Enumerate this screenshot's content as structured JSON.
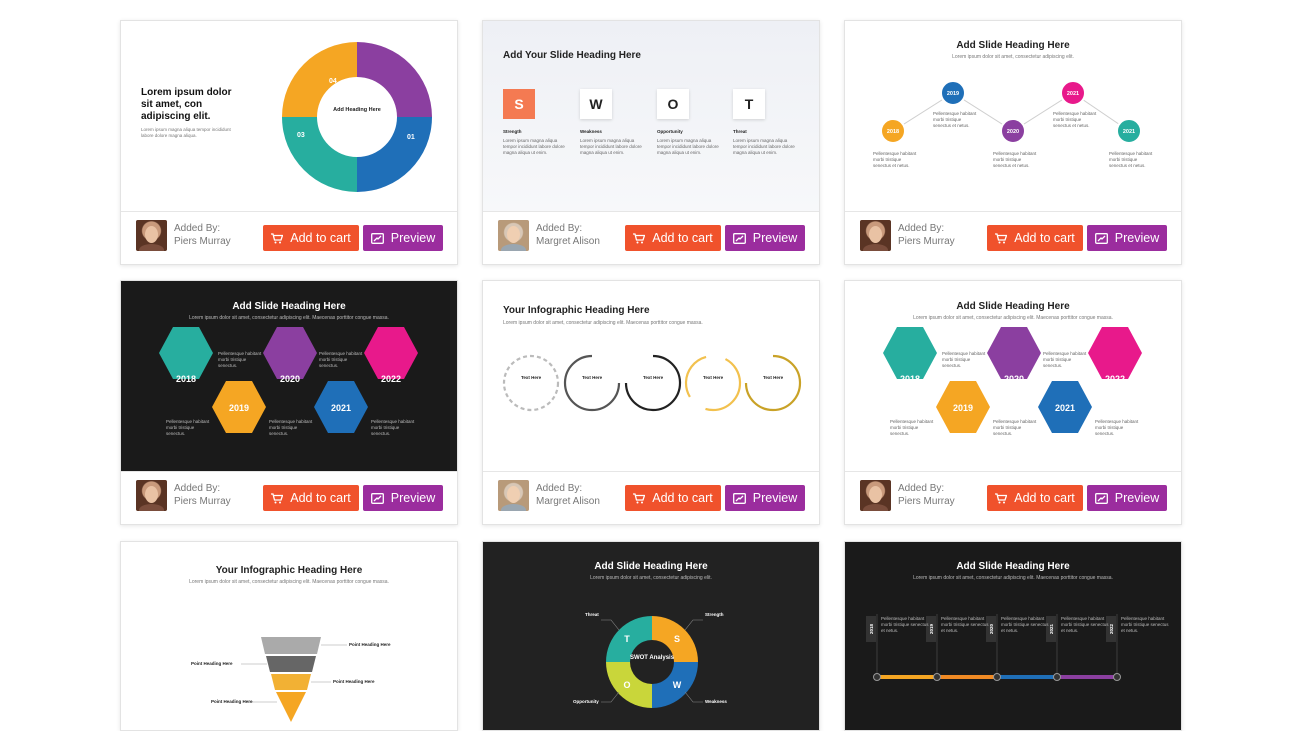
{
  "colors": {
    "cart": "#f0522c",
    "preview": "#9b2d9e"
  },
  "cards": [
    {
      "author_label": "Added By:",
      "author": "Piers Murray",
      "cart_label": "Add to cart",
      "preview_label": "Preview",
      "lead": "Lorem ipsum dolor sit amet, con adipiscing elit.",
      "center": "Add Heading Here",
      "segments": [
        "04",
        "01",
        "02",
        "03"
      ]
    },
    {
      "author_label": "Added By:",
      "author": "Margret Alison",
      "cart_label": "Add to cart",
      "preview_label": "Preview",
      "title": "Add Your Slide Heading Here",
      "letters": [
        "S",
        "W",
        "O",
        "T"
      ],
      "labels": [
        "Strength",
        "Weakness",
        "Opportunity",
        "Threat"
      ]
    },
    {
      "author_label": "Added By:",
      "author": "Piers Murray",
      "cart_label": "Add to cart",
      "preview_label": "Preview",
      "title": "Add Slide Heading Here",
      "years": [
        "2018",
        "2019",
        "2020",
        "2021",
        "2021"
      ]
    },
    {
      "author_label": "Added By:",
      "author": "Piers Murray",
      "cart_label": "Add to cart",
      "preview_label": "Preview",
      "title": "Add Slide Heading Here",
      "years": [
        "2018",
        "2019",
        "2020",
        "2021",
        "2022"
      ]
    },
    {
      "author_label": "Added By:",
      "author": "Margret Alison",
      "cart_label": "Add to cart",
      "preview_label": "Preview",
      "title": "Your Infographic Heading Here",
      "subtitle": "Lorem ipsum dolor sit amet, consectetur adipiscing elit. Maecenas porttitor congue massa.",
      "item": "Text Here"
    },
    {
      "author_label": "Added By:",
      "author": "Piers Murray",
      "cart_label": "Add to cart",
      "preview_label": "Preview",
      "title": "Add Slide Heading Here",
      "years": [
        "2018",
        "2019",
        "2020",
        "2021",
        "2022"
      ]
    },
    {
      "title": "Your Infographic Heading Here",
      "subtitle": "Lorem ipsum dolor sit amet, consectetur adipiscing elit. Maecenas porttitor congue massa.",
      "point": "Point Heading Here"
    },
    {
      "title": "Add Slide Heading Here",
      "center": "SWOT Analysis",
      "letters": [
        "S",
        "W",
        "O",
        "T"
      ],
      "labels": [
        "Threat",
        "Strength",
        "Opportunity",
        "Weakness"
      ]
    },
    {
      "title": "Add Slide Heading Here",
      "years": [
        "2018",
        "2019",
        "2020",
        "2021",
        "2022"
      ]
    }
  ]
}
